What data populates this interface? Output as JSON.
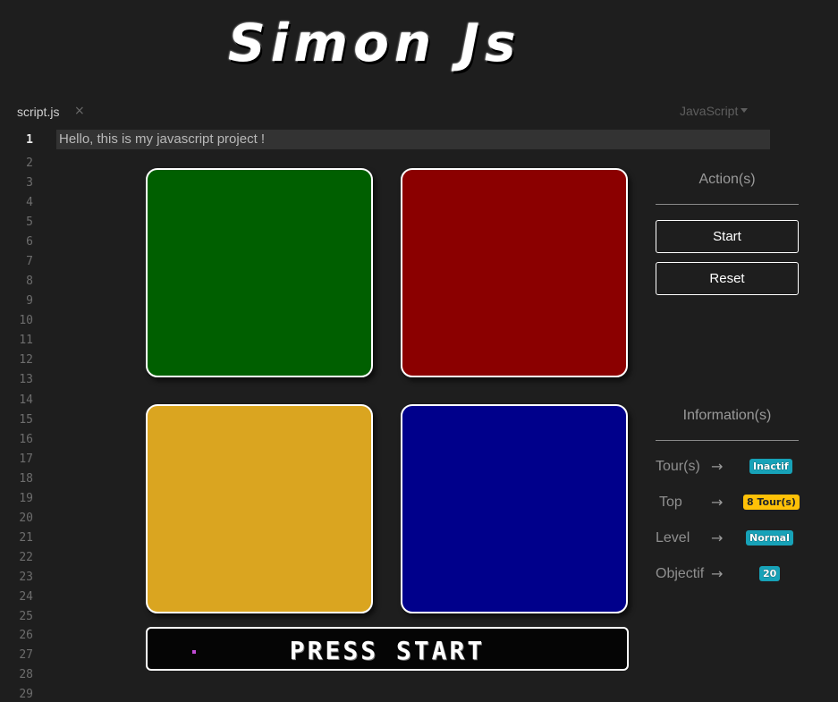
{
  "app": {
    "title": "Simon Js"
  },
  "editor": {
    "tab_name": "script.js",
    "tab_close": "×",
    "language": "JavaScript",
    "active_line": 1,
    "line_text": "Hello, this is my javascript project !",
    "line_numbers": [
      "1",
      "2",
      "3",
      "4",
      "5",
      "6",
      "7",
      "8",
      "9",
      "10",
      "11",
      "12",
      "13",
      "14",
      "15",
      "16",
      "17",
      "18",
      "19",
      "20",
      "21",
      "22",
      "23",
      "24",
      "25",
      "26",
      "27",
      "28",
      "29"
    ]
  },
  "game": {
    "pads": [
      {
        "id": "green",
        "color": "#005f00"
      },
      {
        "id": "red",
        "color": "#8b0000"
      },
      {
        "id": "yellow",
        "color": "#daa520"
      },
      {
        "id": "blue",
        "color": "#00008b"
      }
    ],
    "marquee_text": "PRESS START"
  },
  "actions": {
    "heading": "Action(s)",
    "start_label": "Start",
    "reset_label": "Reset"
  },
  "info": {
    "heading": "Information(s)",
    "arrow": "→",
    "rows": [
      {
        "label": "Tour(s)",
        "value": "Inactif",
        "color": "#17a2b8"
      },
      {
        "label": "Top",
        "value": "8 Tour(s)",
        "color": "#ffc107"
      },
      {
        "label": "Level",
        "value": "Normal",
        "color": "#17a2b8"
      },
      {
        "label": "Objectif",
        "value": "20",
        "color": "#17a2b8"
      }
    ]
  }
}
